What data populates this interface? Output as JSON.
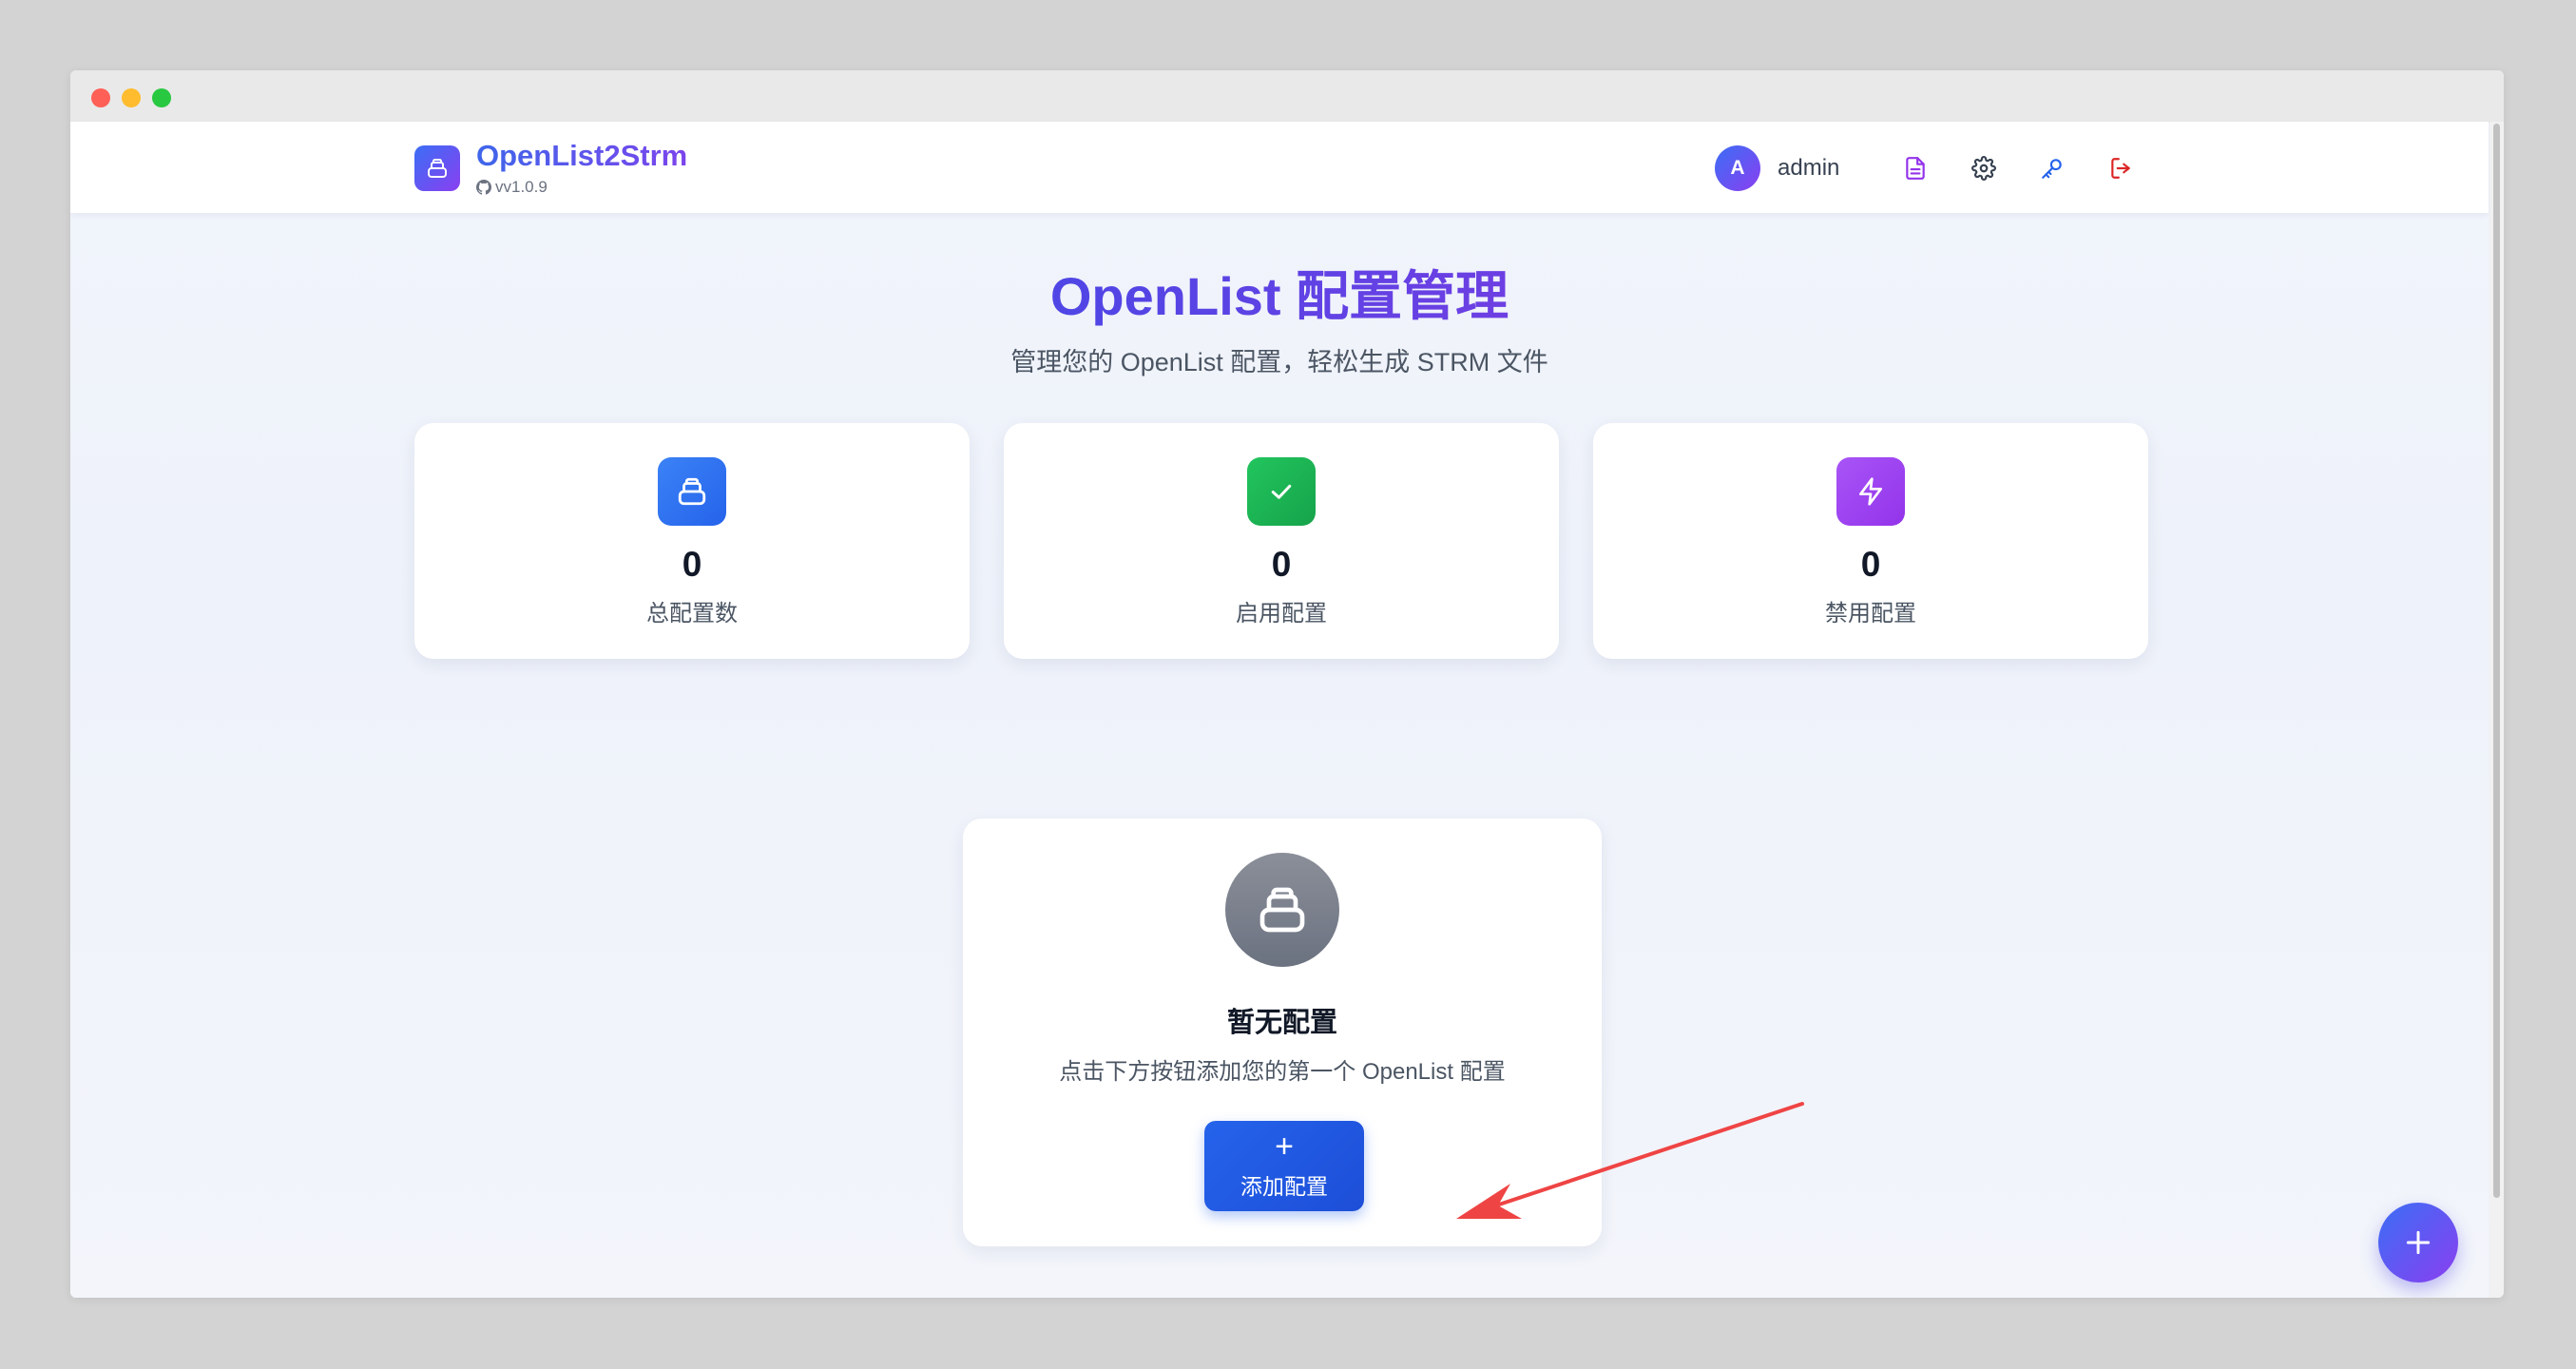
{
  "app": {
    "name": "OpenList2Strm",
    "version": "vv1.0.9"
  },
  "user": {
    "avatar_letter": "A",
    "name": "admin"
  },
  "nav_icons": [
    "document-icon",
    "settings-icon",
    "key-icon",
    "logout-icon"
  ],
  "header": {
    "title": "OpenList 配置管理",
    "subtitle": "管理您的 OpenList 配置，轻松生成 STRM 文件"
  },
  "stats": [
    {
      "value": "0",
      "label": "总配置数",
      "icon": "database-icon",
      "color": "#3b6ef5"
    },
    {
      "value": "0",
      "label": "启用配置",
      "icon": "check-icon",
      "color": "#16a34a"
    },
    {
      "value": "0",
      "label": "禁用配置",
      "icon": "bolt-icon",
      "color": "#9333ea"
    }
  ],
  "empty_state": {
    "title": "暂无配置",
    "description": "点击下方按钮添加您的第一个 OpenList 配置",
    "button_plus": "+",
    "button_label": "添加配置"
  },
  "colors": {
    "brand_gradient_start": "#3b6ef5",
    "brand_gradient_end": "#8a3ff0",
    "annotation_arrow": "#ef4444"
  }
}
